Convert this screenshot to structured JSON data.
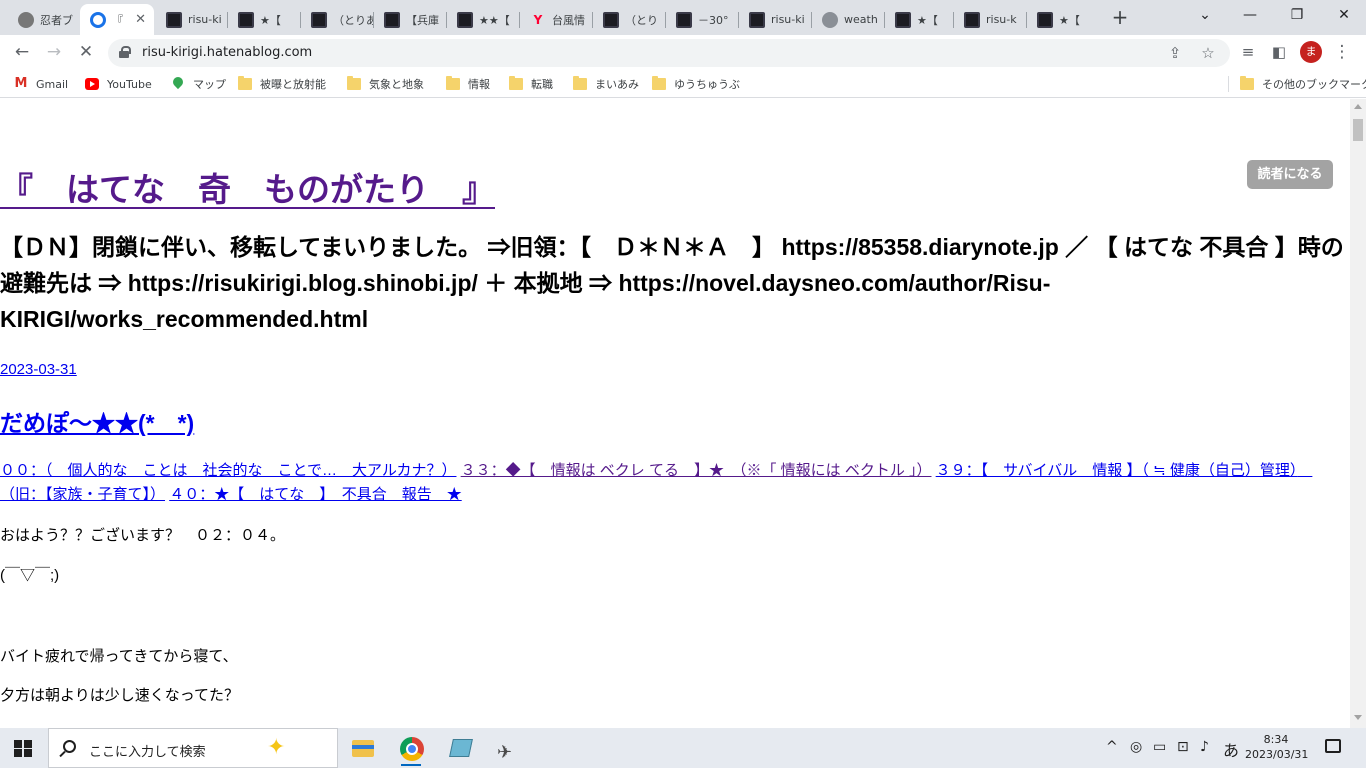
{
  "browser": {
    "tabs": [
      {
        "title": "忍者ブ",
        "favicon": "ninja-icon",
        "active": false
      },
      {
        "title": "『",
        "favicon": "hatena-icon",
        "active": true
      },
      {
        "title": "risu-ki",
        "favicon": "blog-icon",
        "active": false
      },
      {
        "title": "★【",
        "favicon": "blog-icon",
        "active": false
      },
      {
        "title": "（とりあ",
        "favicon": "blog-icon",
        "active": false
      },
      {
        "title": "【兵庫",
        "favicon": "blog-icon",
        "active": false
      },
      {
        "title": "★★【",
        "favicon": "blog-icon",
        "active": false
      },
      {
        "title": "台風情",
        "favicon": "yahoo-icon",
        "active": false
      },
      {
        "title": "（とり",
        "favicon": "blog-icon",
        "active": false
      },
      {
        "title": "－30°",
        "favicon": "blog-icon",
        "active": false
      },
      {
        "title": "risu-ki",
        "favicon": "blog-icon",
        "active": false
      },
      {
        "title": "weath",
        "favicon": "globe-icon",
        "active": false
      },
      {
        "title": "★【",
        "favicon": "blog-icon",
        "active": false
      },
      {
        "title": "risu-k",
        "favicon": "blog-icon",
        "active": false
      },
      {
        "title": "★【",
        "favicon": "blog-icon",
        "active": false
      }
    ],
    "new_tab": "+",
    "url": "risu-kirigi.hatenablog.com",
    "profile_initial": "ま",
    "bookmarks": [
      {
        "label": "Gmail",
        "icon": "gmail-icon"
      },
      {
        "label": "YouTube",
        "icon": "youtube-icon"
      },
      {
        "label": "マップ",
        "icon": "maps-icon"
      },
      {
        "label": "被曝と放射能",
        "icon": "folder-icon"
      },
      {
        "label": "気象と地象",
        "icon": "folder-icon"
      },
      {
        "label": "情報",
        "icon": "folder-icon"
      },
      {
        "label": "転職",
        "icon": "folder-icon"
      },
      {
        "label": "まいあみ",
        "icon": "folder-icon"
      },
      {
        "label": "ゆうちゅうぶ",
        "icon": "folder-icon"
      }
    ],
    "other_bookmarks": "その他のブックマーク"
  },
  "page": {
    "blog_title": "『　はてな　奇　ものがたり　』",
    "subscribe_label": "読者になる",
    "blog_description": "【ＤＮ】閉鎖に伴い、移転してまいりました。 ⇒旧領：【　Ｄ＊Ｎ＊Ａ　】 https://85358.diarynote.jp ／ 【 はてな 不具合 】時の避難先は ⇒ https://risukirigi.blog.shinobi.jp/ ＋ 本拠地 ⇒ https://novel.daysneo.com/author/Risu-KIRIGI/works_recommended.html",
    "entry_date": "2023-03-31",
    "entry_title": "だめぽ～★★(*　*)",
    "categories": [
      "００：（　個人的な　ことは　社会的な　ことで…　大アルカナ？）",
      "３３：◆【　情報は ベクレ てる　】★　（※「 情報には ベクトル 」）",
      "３９：【　サバイバル　情報 】（ ≒ 健康（自己）管理）　（旧：【家族・子育て】）",
      "４０：★【　はてな　】　不具合　報告　★"
    ],
    "paragraphs": [
      "おはよう？？ございます？　０２：０４。",
      "(￣▽￣;)",
      "バイト疲れで帰ってきてから寝て、",
      "夕方は朝よりは少し速くなってた？"
    ]
  },
  "taskbar": {
    "search_placeholder": "ここに入力して検索",
    "ime_label": "あ",
    "time": "8:34",
    "date": "2023/03/31"
  }
}
